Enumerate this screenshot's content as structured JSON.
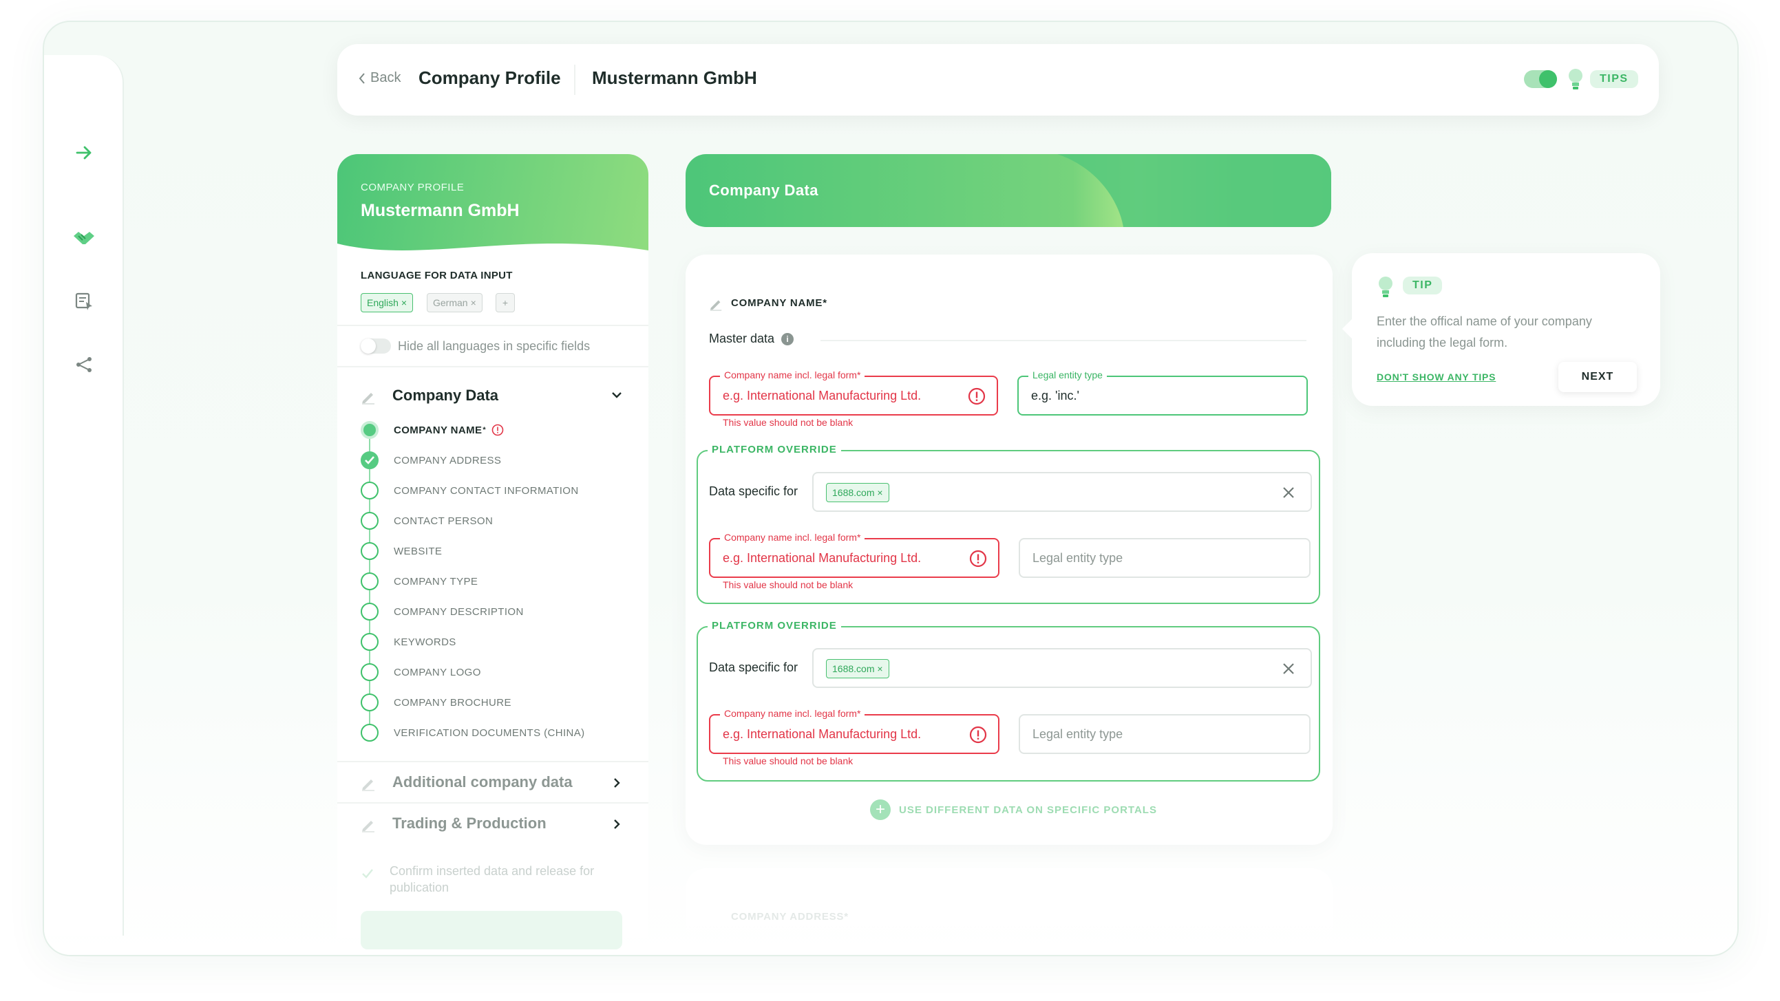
{
  "header": {
    "back_label": "Back",
    "title": "Company Profile",
    "company": "Mustermann GmbH",
    "tips_label": "TIPS",
    "tips_toggle_on": true
  },
  "rail": {
    "icons": [
      "arrow-right-icon",
      "handshake-icon",
      "form-cursor-icon",
      "share-icon"
    ]
  },
  "sidebar": {
    "eyebrow": "COMPANY PROFILE",
    "company": "Mustermann GmbH",
    "language_label": "LANGUAGE FOR DATA INPUT",
    "languages": [
      {
        "label": "English",
        "selected": true
      },
      {
        "label": "German",
        "selected": false
      }
    ],
    "add_language": "+",
    "hide_languages_label": "Hide all languages in specific fields",
    "sections": [
      {
        "title": "Company Data",
        "expanded": true
      },
      {
        "title": "Additional company data",
        "expanded": false
      },
      {
        "title": "Trading & Production",
        "expanded": false
      }
    ],
    "steps": [
      {
        "label": "COMPANY NAME",
        "required_mark": "*",
        "state": "active",
        "error": true
      },
      {
        "label": "COMPANY ADDRESS",
        "state": "done"
      },
      {
        "label": "COMPANY CONTACT INFORMATION",
        "state": "todo"
      },
      {
        "label": "CONTACT PERSON",
        "state": "todo"
      },
      {
        "label": "WEBSITE",
        "state": "todo"
      },
      {
        "label": "COMPANY TYPE",
        "state": "todo"
      },
      {
        "label": "COMPANY DESCRIPTION",
        "state": "todo"
      },
      {
        "label": "KEYWORDS",
        "state": "todo"
      },
      {
        "label": "COMPANY LOGO",
        "state": "todo"
      },
      {
        "label": "COMPANY BROCHURE",
        "state": "todo"
      },
      {
        "label": "VERIFICATION DOCUMENTS (CHINA)",
        "state": "todo"
      }
    ],
    "confirm_text": "Confirm inserted data and release for publication"
  },
  "banner": {
    "title": "Company Data"
  },
  "form": {
    "field_title": "COMPANY NAME*",
    "master_label": "Master data",
    "master": {
      "name_legend": "Company name incl. legal form*",
      "name_placeholder": "e.g. International Manufacturing Ltd.",
      "name_error": "This value should not be blank",
      "entity_legend": "Legal entity type",
      "entity_value": "e.g. 'inc.'"
    },
    "overrides": [
      {
        "legend": "PLATFORM OVERRIDE",
        "data_specific_label": "Data specific for",
        "portal": "1688.com",
        "name_legend": "Company name incl. legal form*",
        "name_placeholder": "e.g. International Manufacturing Ltd.",
        "name_error": "This value should not be blank",
        "entity_placeholder": "Legal entity type"
      },
      {
        "legend": "PLATFORM OVERRIDE",
        "data_specific_label": "Data specific for",
        "portal": "1688.com",
        "name_legend": "Company name incl. legal form*",
        "name_placeholder": "e.g. International Manufacturing Ltd.",
        "name_error": "This value should not be blank",
        "entity_placeholder": "Legal entity type"
      }
    ],
    "add_portal_label": "USE DIFFERENT DATA ON SPECIFIC PORTALS",
    "next_field_title": "COMPANY ADDRESS*"
  },
  "tip": {
    "pill": "TIP",
    "text": "Enter the offical name of your company including the legal form.",
    "dont_show": "DON'T SHOW ANY TIPS",
    "next": "NEXT"
  },
  "colors": {
    "accent": "#3fc16b",
    "error": "#e23547",
    "text": "#1f2d2a"
  }
}
